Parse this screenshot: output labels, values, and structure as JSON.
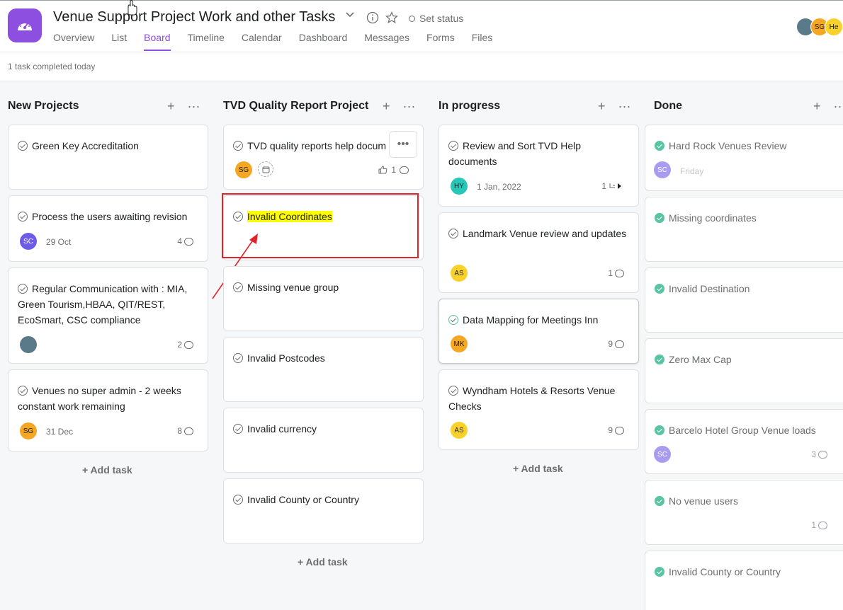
{
  "project": {
    "title": "Venue Support Project Work and other Tasks",
    "set_status": "Set status",
    "tabs": [
      "Overview",
      "List",
      "Board",
      "Timeline",
      "Calendar",
      "Dashboard",
      "Messages",
      "Forms",
      "Files"
    ],
    "active_tab": "Board",
    "header_avatars": [
      {
        "initials": "",
        "color": "#5a7a8a"
      },
      {
        "initials": "SG",
        "color": "#f5a623"
      },
      {
        "initials": "He",
        "color": "#f8d22a"
      }
    ]
  },
  "subbar": {
    "completed_text": "1 task completed today"
  },
  "columns": [
    {
      "name": "New Projects",
      "add_task": "+ Add task",
      "cards": [
        {
          "title": "Green Key Accreditation"
        },
        {
          "title": "Process the users awaiting revision",
          "avatar": "SC",
          "avatar_color": "#6c5ce7",
          "date": "29 Oct",
          "comments": "4"
        },
        {
          "title": "Regular Communication with : MIA, Green Tourism,HBAA, QIT/REST, EcoSmart, CSC compliance",
          "avatar": "",
          "avatar_color": "#5a7a8a",
          "comments": "2"
        },
        {
          "title": "Venues no super admin - 2 weeks constant work remaining",
          "avatar": "SG",
          "avatar_color": "#f5a623",
          "date": "31 Dec",
          "comments": "8"
        }
      ]
    },
    {
      "name": "TVD Quality Report Project",
      "add_task": "+ Add task",
      "cards": [
        {
          "title": "TVD quality reports help docum",
          "avatar": "SG",
          "avatar_color": "#f5a623",
          "likes": "1"
        },
        {
          "title": "Invalid Coordinates"
        },
        {
          "title": "Missing venue group"
        },
        {
          "title": "Invalid Postcodes"
        },
        {
          "title": "Invalid currency"
        },
        {
          "title": "Invalid County or Country"
        }
      ]
    },
    {
      "name": "In progress",
      "add_task": "+ Add task",
      "cards": [
        {
          "title": "Review and Sort TVD Help documents",
          "avatar": "HY",
          "avatar_color": "#27c7b8",
          "date": "1 Jan, 2022",
          "subtasks": "1"
        },
        {
          "title": "Landmark Venue review and updates",
          "avatar": "AS",
          "avatar_color": "#f8d22a",
          "comments": "1"
        },
        {
          "title": "Data Mapping for Meetings Inn",
          "avatar": "MK",
          "avatar_color": "#f5a623",
          "comments": "9"
        },
        {
          "title": "Wyndham Hotels & Resorts Venue Checks",
          "avatar": "AS",
          "avatar_color": "#f8d22a",
          "comments": "9"
        }
      ]
    },
    {
      "name": "Done",
      "cards": [
        {
          "title": "Hard Rock Venues Review",
          "avatar": "SC",
          "avatar_color": "#a99cf0",
          "date": "Friday"
        },
        {
          "title": "Missing coordinates"
        },
        {
          "title": "Invalid Destination"
        },
        {
          "title": "Zero Max Cap"
        },
        {
          "title": "Barcelo Hotel Group Venue loads",
          "avatar": "SC",
          "avatar_color": "#a99cf0",
          "comments": "3"
        },
        {
          "title": "No venue users",
          "comments": "1"
        },
        {
          "title": "Invalid County or Country"
        }
      ]
    }
  ]
}
